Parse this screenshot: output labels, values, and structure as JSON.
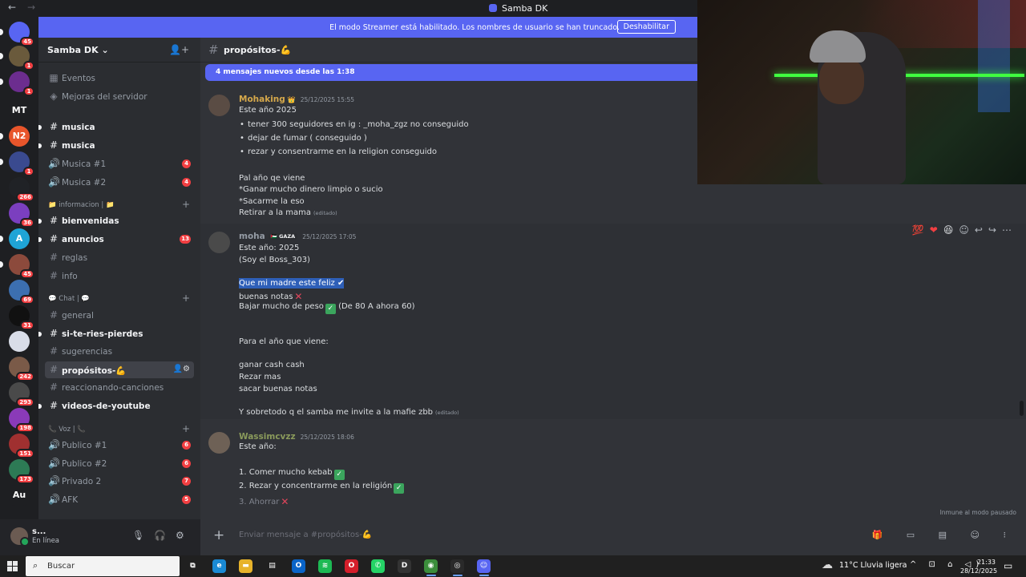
{
  "window": {
    "title": "Samba DK",
    "back": "←",
    "forward": "→"
  },
  "streamer_banner": {
    "text": "El modo Streamer está habilitado. Los nombres de usuario se han truncado.",
    "button": "Deshabilitar"
  },
  "servers": [
    {
      "label": "",
      "badge": "45",
      "color": "#5865f2",
      "glyph": "☺"
    },
    {
      "label": "",
      "badge": "1",
      "color": "#6a5a3c"
    },
    {
      "label": "",
      "badge": "1",
      "color": "#6c2d8f"
    },
    {
      "label": "MT",
      "badge": "",
      "color": "#1e1f22"
    },
    {
      "label": "N2",
      "badge": "",
      "color": "#e8552b"
    },
    {
      "label": "",
      "badge": "1",
      "color": "#3a4a8f"
    },
    {
      "label": "",
      "badge": "266",
      "color": "#202226"
    },
    {
      "label": "",
      "badge": "36",
      "color": "#7b3fbf"
    },
    {
      "label": "A",
      "badge": "",
      "color": "#1fa4d6"
    },
    {
      "label": "",
      "badge": "45",
      "color": "#8c4a3c"
    },
    {
      "label": "",
      "badge": "69",
      "color": "#3c6fb0"
    },
    {
      "label": "",
      "badge": "31",
      "color": "#111111"
    },
    {
      "label": "",
      "badge": "",
      "color": "#d9dde8"
    },
    {
      "label": "",
      "badge": "242",
      "color": "#7a5a48"
    },
    {
      "label": "",
      "badge": "293",
      "color": "#4a4a4a"
    },
    {
      "label": "",
      "badge": "198",
      "color": "#8a3ab8"
    },
    {
      "label": "",
      "badge": "151",
      "color": "#a03030"
    },
    {
      "label": "",
      "badge": "173",
      "color": "#2d7a55"
    },
    {
      "label": "Au",
      "badge": "",
      "color": "#1e1f22"
    }
  ],
  "sidebar": {
    "server_name": "Samba DK",
    "chevron": "⌄",
    "invite_icon": "👤+",
    "top_items": [
      {
        "label": "Eventos",
        "icon": "▦"
      },
      {
        "label": "Mejoras del servidor",
        "icon": "◈"
      }
    ],
    "channels_a": [
      {
        "label": "musica",
        "icon": "#",
        "unread": true,
        "count": ""
      },
      {
        "label": "musica",
        "icon": "#",
        "unread": true,
        "count": ""
      },
      {
        "label": "Musica #1",
        "icon": "🔊",
        "unread": false,
        "count": "4"
      },
      {
        "label": "Musica #2",
        "icon": "🔊",
        "unread": false,
        "count": "4"
      }
    ],
    "category_info": "📁 informacion | 📁",
    "channels_b": [
      {
        "label": "bienvenidas",
        "icon": "#",
        "unread": true,
        "count": ""
      },
      {
        "label": "anuncios",
        "icon": "#",
        "unread": true,
        "count": "13"
      },
      {
        "label": "reglas",
        "icon": "#",
        "unread": false,
        "count": ""
      },
      {
        "label": "info",
        "icon": "#",
        "unread": false,
        "count": ""
      }
    ],
    "category_chat": "💬 Chat | 💬",
    "channels_c": [
      {
        "label": "general",
        "icon": "#",
        "unread": false
      },
      {
        "label": "si-te-ries-pierdes",
        "icon": "#",
        "unread": true
      },
      {
        "label": "sugerencias",
        "icon": "#",
        "unread": false
      },
      {
        "label": "propósitos-💪",
        "icon": "#",
        "unread": false,
        "active": true
      },
      {
        "label": "reaccionando-canciones",
        "icon": "#",
        "unread": false
      },
      {
        "label": "videos-de-youtube",
        "icon": "#",
        "unread": true
      }
    ],
    "category_voz": "📞 Voz | 📞",
    "channels_d": [
      {
        "label": "Publico #1",
        "icon": "🔊",
        "count": "6"
      },
      {
        "label": "Publico #2",
        "icon": "🔊",
        "count": "6"
      },
      {
        "label": "Privado 2",
        "icon": "🔊",
        "count": "7"
      },
      {
        "label": "AFK",
        "icon": "🔊",
        "count": "5"
      }
    ]
  },
  "user_panel": {
    "name": "s...",
    "status": "En línea",
    "mic": "🎙",
    "headset": "🎧",
    "settings": "⚙"
  },
  "chat": {
    "channel_title": "propósitos-💪",
    "new_messages": "4 mensajes nuevos desde las 1:38",
    "messages": [
      {
        "author": "Mohaking",
        "author_color": "#d5a84b",
        "badge": "👑",
        "timestamp": "25/12/2025 15:55",
        "lines": [
          {
            "text": "Este año 2025",
            "bullet": false
          },
          {
            "text": "tener 300 seguidores en  ig : _moha_zgz no conseguido",
            "bullet": true
          },
          {
            "text": "dejar de fumar ( conseguido )",
            "bullet": true
          },
          {
            "text": "rezar y consentrarme en la religion conseguido",
            "bullet": true
          },
          {
            "text": " Pal año qe viene",
            "bullet": false
          },
          {
            "text": "*Ganar mucho dinero limpio o sucio",
            "bullet": false
          },
          {
            "text": "*Sacarme la  eso",
            "bullet": false
          },
          {
            "text": "Retirar a la mama",
            "bullet": false,
            "edited": "(editado)"
          }
        ]
      },
      {
        "author": "moha",
        "author_color": "#949ba4",
        "tag": "🇵🇸 GAZA",
        "timestamp": "25/12/2025 17:05",
        "lines": [
          {
            "text": "Este año: 2025"
          },
          {
            "text": "(Soy el Boss_303)"
          },
          {
            "text": "Que mi madre este feliz",
            "highlight": true
          },
          {
            "text": "buenas notas",
            "mark": "✕"
          },
          {
            "text": "Bajar mucho de peso",
            "mark": "✓",
            "after": " (De 80 A ahora 60)"
          },
          {
            "text": "Para el año que viene:"
          },
          {
            "text": "ganar cash cash"
          },
          {
            "text": "Rezar mas"
          },
          {
            "text": "sacar buenas notas"
          },
          {
            "text": "Y sobretodo q el samba me invite a la mafie zbb",
            "edited": "(editado)"
          }
        ]
      },
      {
        "author": "Wassimcvzz",
        "author_color": "#8a9a5b",
        "timestamp": "25/12/2025 18:06",
        "lines": [
          {
            "text": "Este año:"
          },
          {
            "text": "1. Comer mucho kebab",
            "mark": "✓"
          },
          {
            "text": "2. Rezar y concentrarme en la religión",
            "mark": "✓"
          },
          {
            "text": "3. Ahorrar",
            "mark": "✕",
            "faded": true
          }
        ]
      }
    ],
    "reactions": [
      "💯",
      "❤",
      "😆",
      "☺",
      "↩",
      "↪",
      "⋯"
    ],
    "immune_text": "Inmune al modo pausado",
    "composer_placeholder": "Enviar mensaje a #propósitos-💪",
    "composer_icons": "🎁 ▭ ▤ ☺ ⁝"
  },
  "taskbar": {
    "search_placeholder": "Buscar",
    "apps": [
      {
        "name": "taskview",
        "color": "#202020",
        "glyph": "⧉"
      },
      {
        "name": "edge",
        "color": "#1a8ad4",
        "glyph": "e"
      },
      {
        "name": "explorer",
        "color": "#e7b32a",
        "glyph": "▬"
      },
      {
        "name": "store",
        "color": "#2b2b2b",
        "glyph": "▤"
      },
      {
        "name": "outlook",
        "color": "#0a64c8",
        "glyph": "O"
      },
      {
        "name": "spotify",
        "color": "#1db954",
        "glyph": "≋"
      },
      {
        "name": "opera",
        "color": "#d41f2b",
        "glyph": "O"
      },
      {
        "name": "whatsapp",
        "color": "#25d366",
        "glyph": "✆"
      },
      {
        "name": "dark-app",
        "color": "#333333",
        "glyph": "D"
      },
      {
        "name": "chrome",
        "color": "#3b8d3b",
        "glyph": "◉"
      },
      {
        "name": "browser",
        "color": "#2a2a2a",
        "glyph": "◎"
      },
      {
        "name": "discord",
        "color": "#5865f2",
        "glyph": "☺"
      }
    ],
    "weather": "11°C  Lluvia ligera",
    "tray": "^ ⊡ ⌂ ◁)",
    "time": "21:33",
    "date": "28/12/2025"
  }
}
